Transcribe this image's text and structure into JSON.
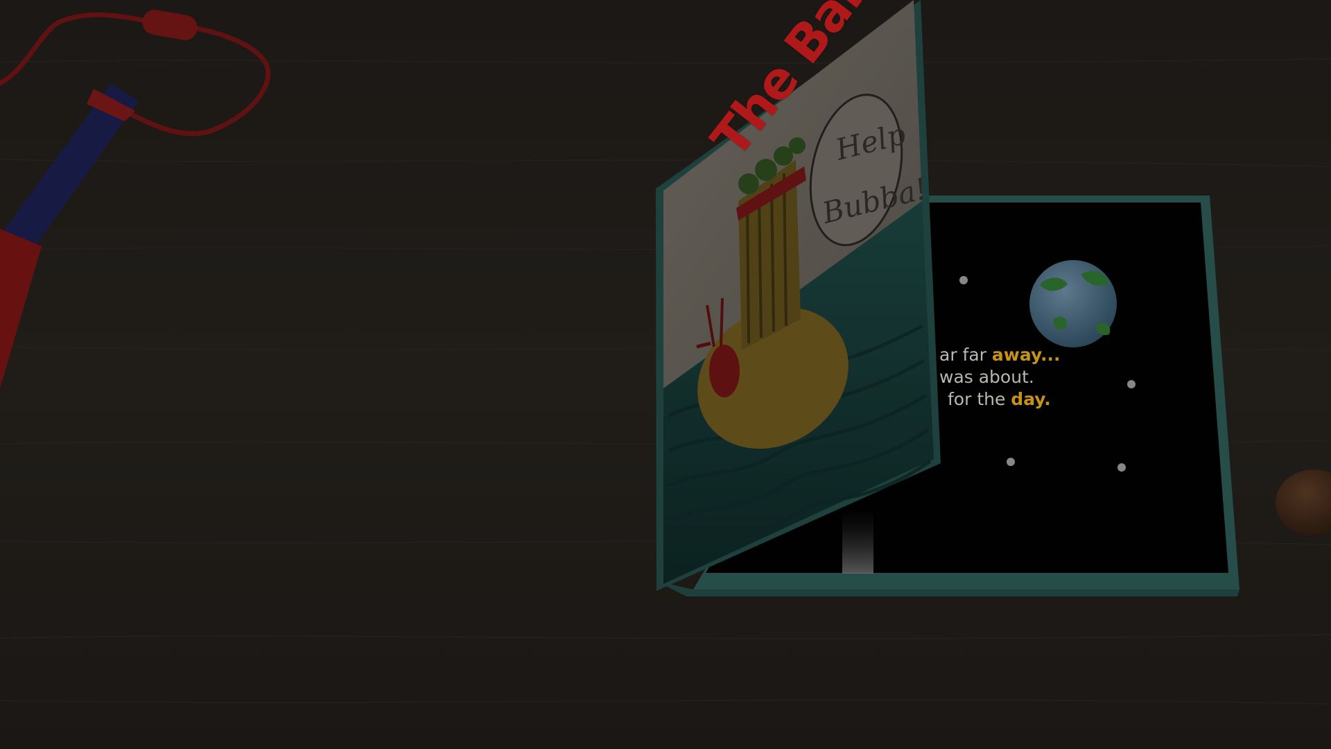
{
  "book": {
    "cover_title": "The Bangles",
    "speech_bubble": {
      "line1": "Help",
      "line2": "Bubba!"
    },
    "story_text": [
      {
        "plain": "ar far ",
        "highlight": "away..."
      },
      {
        "plain": "was about.",
        "highlight": ""
      },
      {
        "plain": "for the ",
        "highlight": "day."
      }
    ]
  },
  "colors": {
    "table": "#231f1c",
    "book_edge": "#2f5a55",
    "page_dark": "#020202",
    "cover_paper": "#67625a",
    "sea": "#153a36",
    "title_red": "#b01919",
    "title_green": "#1e7a1e",
    "highlight_yellow": "#c69317",
    "story_white": "#b9b7ae"
  },
  "icons": {
    "pen": "pen-icon",
    "planet": "earth-icon",
    "crab": "crab-icon",
    "acorn": "acorn-icon"
  }
}
